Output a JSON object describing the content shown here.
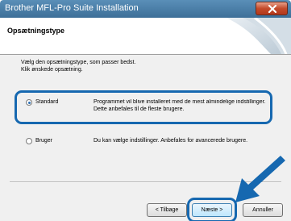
{
  "window": {
    "title": "Brother MFL-Pro Suite Installation"
  },
  "header": {
    "title": "Opsætningstype"
  },
  "content": {
    "instruction_line1": "Vælg den opsætningstype, som passer bedst.",
    "instruction_line2": "Klik ønskede opsætning."
  },
  "options": [
    {
      "label": "Standard",
      "checked": true,
      "desc_line1": "Programmet vil blive installeret med de mest almindelige indstillinger.",
      "desc_line2": "Dette anbefales til de fleste brugere."
    },
    {
      "label": "Bruger",
      "checked": false,
      "desc_line1": "Du kan vælge indstillinger. Anbefales for avancerede brugere."
    }
  ],
  "buttons": {
    "back": "< Tilbage",
    "next": "Næste >",
    "cancel": "Annuller"
  },
  "colors": {
    "highlight": "#1668b0",
    "arrow": "#1668b0",
    "titlebar": "#4a80aa"
  },
  "icons": {
    "close": "close-icon",
    "header_graphic": "swoosh-graphic",
    "pointer": "pointer-arrow-icon"
  }
}
